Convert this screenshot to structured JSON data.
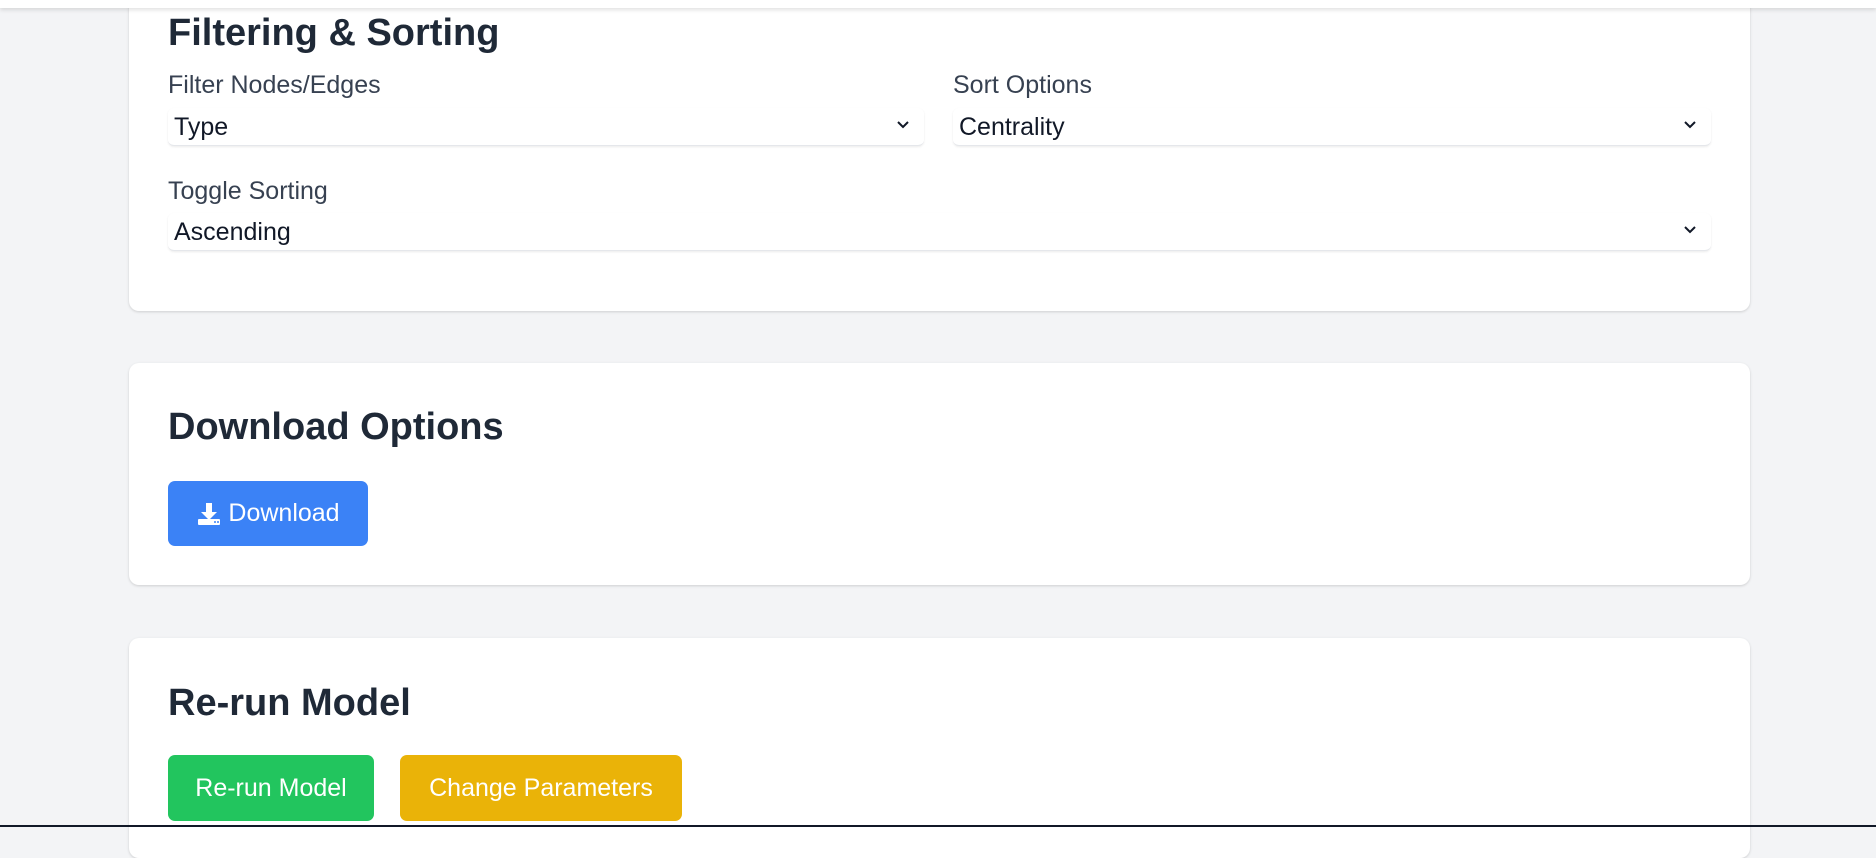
{
  "filtering": {
    "title": "Filtering & Sorting",
    "filter_label": "Filter Nodes/Edges",
    "filter_value": "Type",
    "sort_label": "Sort Options",
    "sort_value": "Centrality",
    "toggle_label": "Toggle Sorting",
    "toggle_value": "Ascending"
  },
  "download": {
    "title": "Download Options",
    "button_label": "Download",
    "button_icon": "download-icon"
  },
  "rerun": {
    "title": "Re-run Model",
    "rerun_button_label": "Re-run Model",
    "change_params_label": "Change Parameters"
  },
  "colors": {
    "page_bg": "#f3f4f6",
    "card_bg": "#ffffff",
    "download_blue": "#3b82f6",
    "rerun_green": "#22c55e",
    "params_yellow": "#eab308"
  }
}
